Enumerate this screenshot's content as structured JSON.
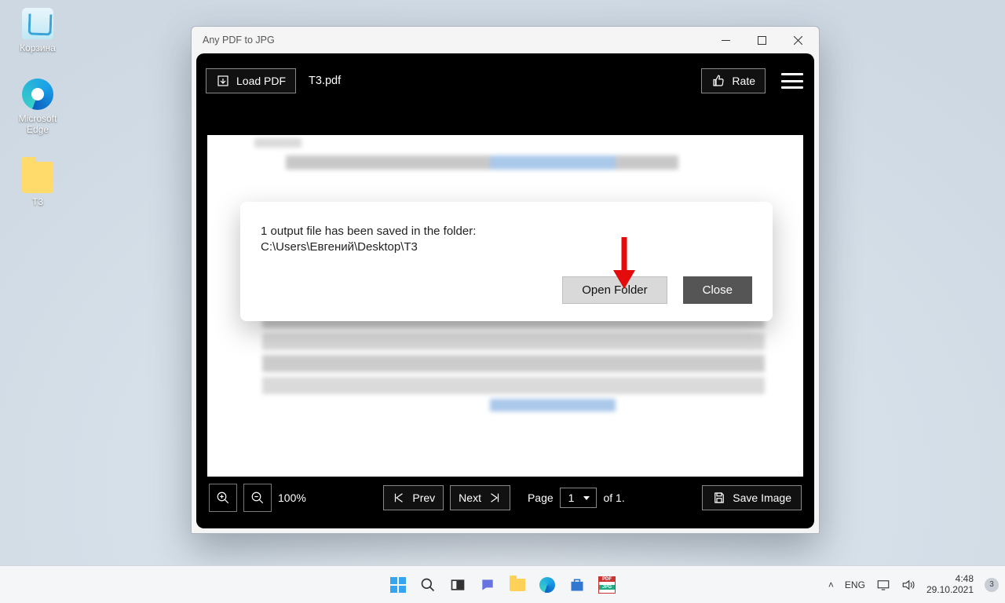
{
  "desktop": {
    "recycle_bin": "Корзина",
    "edge": "Microsoft Edge",
    "folder_t3": "Т3"
  },
  "window": {
    "title": "Any PDF to JPG"
  },
  "toolbar": {
    "load_pdf": "Load PDF",
    "file_name": "T3.pdf",
    "rate": "Rate"
  },
  "dialog": {
    "line1": "1 output file has been saved in the folder:",
    "line2": "C:\\Users\\Евгений\\Desktop\\Т3",
    "open_folder": "Open Folder",
    "close": "Close"
  },
  "footer": {
    "zoom": "100%",
    "prev": "Prev",
    "next": "Next",
    "page_label": "Page",
    "current_page": "1",
    "total_pages": "of 1.",
    "save_image": "Save Image"
  },
  "taskbar": {
    "lang": "ENG",
    "time": "4:48",
    "date": "29.10.2021",
    "notif_count": "3"
  },
  "annotations": {
    "red_arrow": true
  }
}
